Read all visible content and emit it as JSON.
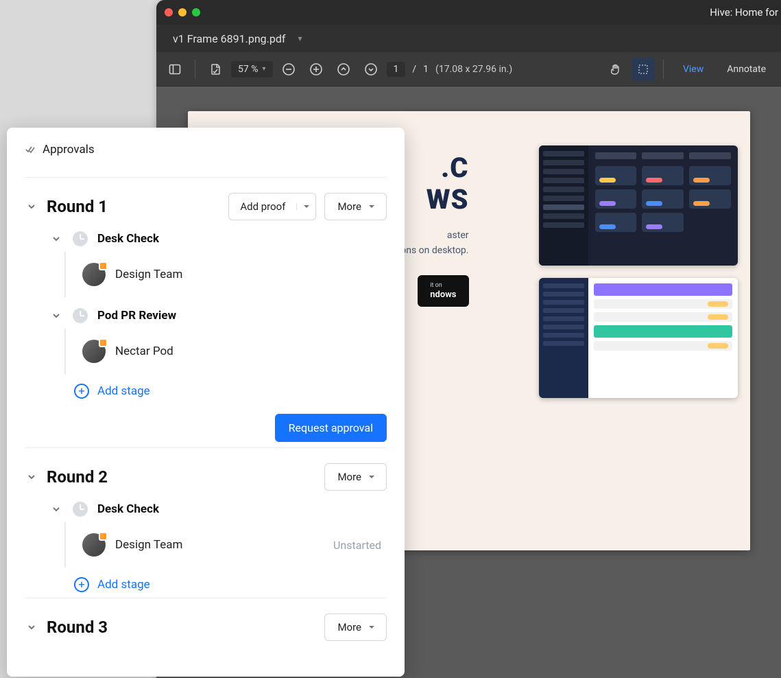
{
  "window": {
    "title": "Hive: Home for",
    "tab_name": "v1 Frame 6891.png.pdf"
  },
  "toolbar": {
    "zoom": "57 %",
    "page_current": "1",
    "page_sep": "/",
    "page_total": "1",
    "dimensions": "(17.08 x 27.96 in.)",
    "view_label": "View",
    "annotate_label": "Annotate"
  },
  "pdf_page": {
    "hero_title_line1": ".C",
    "hero_title_line2": "WS",
    "hero_sub_line1": "aster",
    "hero_sub_line2": "ons on desktop.",
    "download_line1": "it on",
    "download_line2": "ndows"
  },
  "panel": {
    "title": "Approvals",
    "add_proof_label": "Add proof",
    "more_label": "More",
    "add_stage_label": "Add stage",
    "request_label": "Request approval",
    "unstarted_label": "Unstarted",
    "rounds": [
      {
        "title": "Round 1",
        "has_add_proof": true,
        "has_request": true,
        "stages": [
          {
            "title": "Desk Check",
            "reviewers": [
              {
                "name": "Design Team",
                "status": ""
              }
            ]
          },
          {
            "title": "Pod PR Review",
            "reviewers": [
              {
                "name": "Nectar Pod",
                "status": ""
              }
            ]
          }
        ]
      },
      {
        "title": "Round 2",
        "has_add_proof": false,
        "has_request": false,
        "stages": [
          {
            "title": "Desk Check",
            "reviewers": [
              {
                "name": "Design Team",
                "status": "Unstarted"
              }
            ]
          }
        ]
      },
      {
        "title": "Round 3",
        "has_add_proof": false,
        "has_request": false,
        "stages": []
      }
    ]
  }
}
